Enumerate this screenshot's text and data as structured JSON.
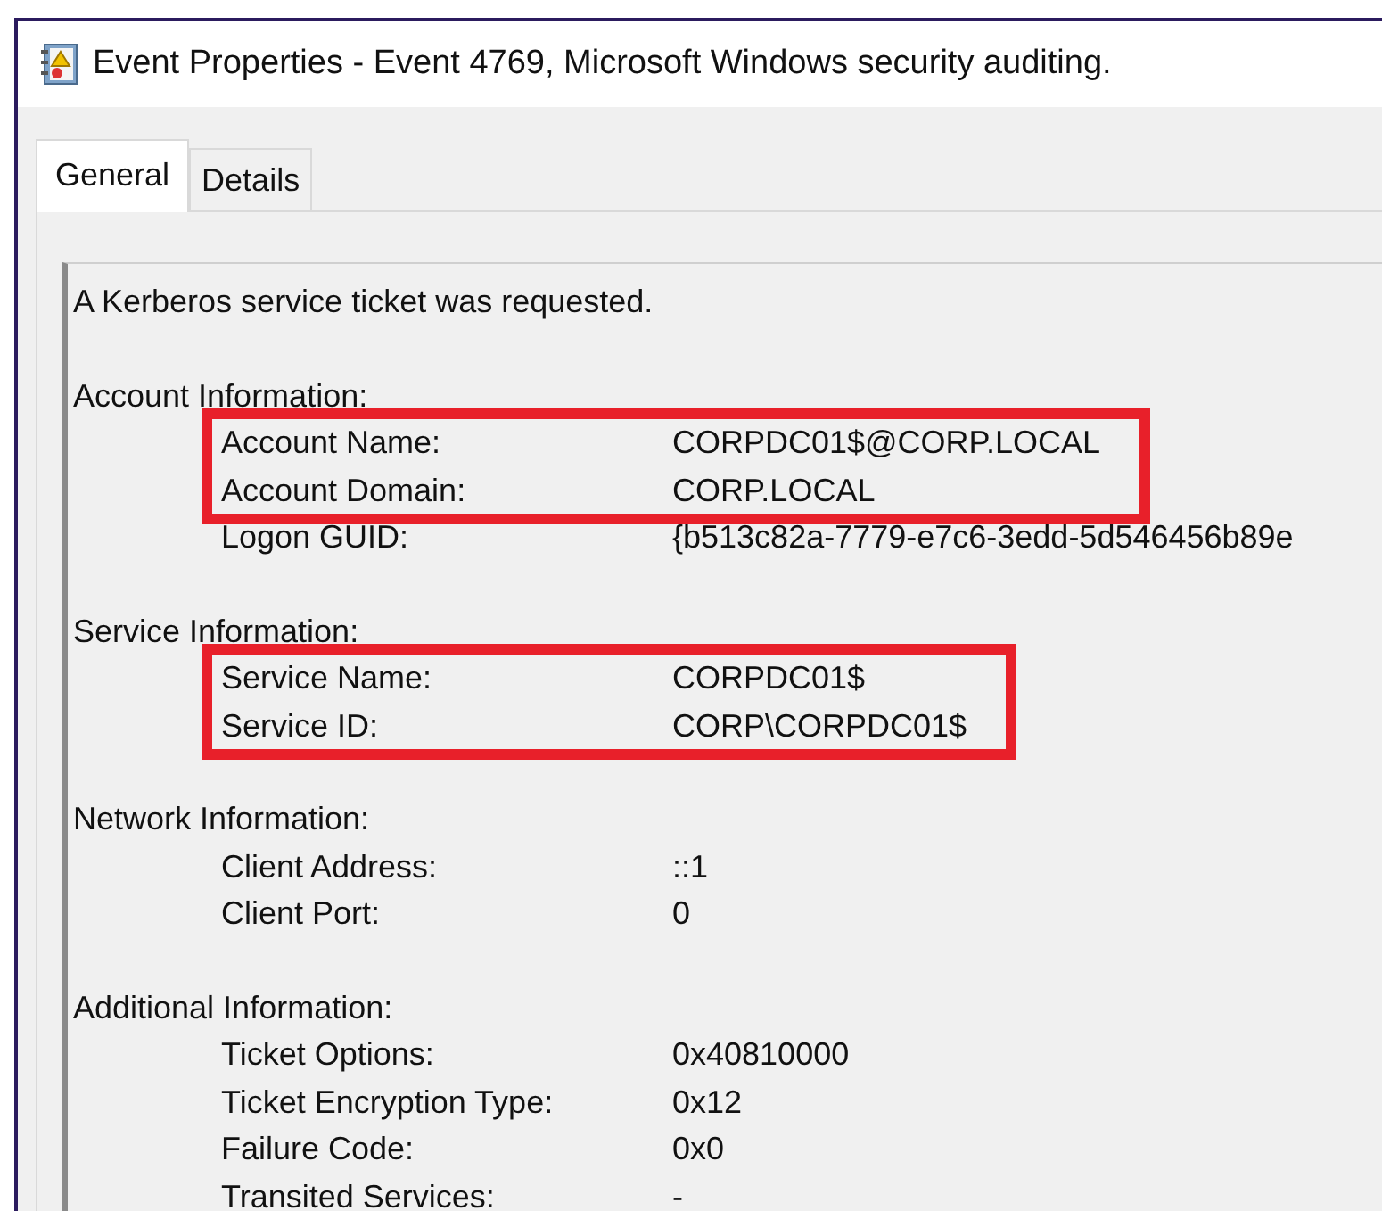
{
  "window": {
    "title": "Event Properties - Event 4769, Microsoft Windows security auditing."
  },
  "tabs": [
    {
      "label": "General",
      "selected": true
    },
    {
      "label": "Details",
      "selected": false
    }
  ],
  "description": {
    "summary": "A Kerberos service ticket was requested.",
    "sections": [
      {
        "heading": "Account Information:",
        "groups": [
          {
            "highlighted": true,
            "fields": [
              {
                "label": "Account Name:",
                "value": "CORPDC01$@CORP.LOCAL"
              },
              {
                "label": "Account Domain:",
                "value": "CORP.LOCAL"
              }
            ]
          },
          {
            "highlighted": false,
            "fields": [
              {
                "label": "Logon GUID:",
                "value": "{b513c82a-7779-e7c6-3edd-5d546456b89e"
              }
            ]
          }
        ]
      },
      {
        "heading": "Service Information:",
        "groups": [
          {
            "highlighted": true,
            "fields": [
              {
                "label": "Service Name:",
                "value": "CORPDC01$"
              },
              {
                "label": "Service ID:",
                "value": "CORP\\CORPDC01$"
              }
            ]
          }
        ]
      },
      {
        "heading": "Network Information:",
        "groups": [
          {
            "highlighted": false,
            "fields": [
              {
                "label": "Client Address:",
                "value": "::1"
              },
              {
                "label": "Client Port:",
                "value": "0"
              }
            ]
          }
        ]
      },
      {
        "heading": "Additional Information:",
        "groups": [
          {
            "highlighted": false,
            "fields": [
              {
                "label": "Ticket Options:",
                "value": "0x40810000"
              },
              {
                "label": "Ticket Encryption Type:",
                "value": "0x12"
              },
              {
                "label": "Failure Code:",
                "value": "0x0"
              },
              {
                "label": "Transited Services:",
                "value": "-"
              }
            ]
          }
        ]
      }
    ]
  }
}
